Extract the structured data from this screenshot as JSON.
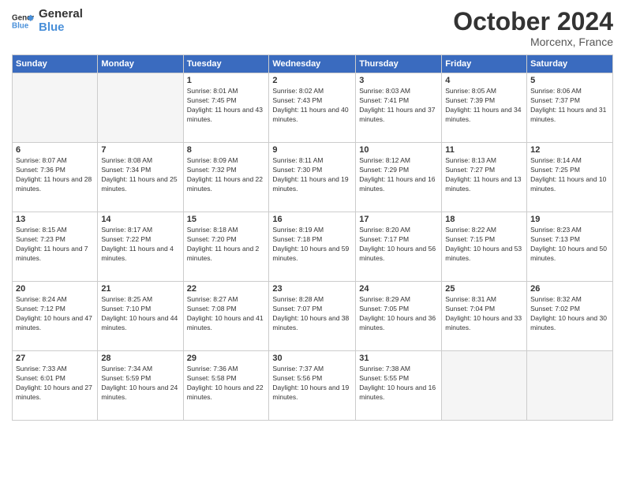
{
  "logo": {
    "line1": "General",
    "line2": "Blue"
  },
  "title": "October 2024",
  "location": "Morcenx, France",
  "days_of_week": [
    "Sunday",
    "Monday",
    "Tuesday",
    "Wednesday",
    "Thursday",
    "Friday",
    "Saturday"
  ],
  "weeks": [
    [
      {
        "day": "",
        "info": ""
      },
      {
        "day": "",
        "info": ""
      },
      {
        "day": "1",
        "info": "Sunrise: 8:01 AM\nSunset: 7:45 PM\nDaylight: 11 hours and 43 minutes."
      },
      {
        "day": "2",
        "info": "Sunrise: 8:02 AM\nSunset: 7:43 PM\nDaylight: 11 hours and 40 minutes."
      },
      {
        "day": "3",
        "info": "Sunrise: 8:03 AM\nSunset: 7:41 PM\nDaylight: 11 hours and 37 minutes."
      },
      {
        "day": "4",
        "info": "Sunrise: 8:05 AM\nSunset: 7:39 PM\nDaylight: 11 hours and 34 minutes."
      },
      {
        "day": "5",
        "info": "Sunrise: 8:06 AM\nSunset: 7:37 PM\nDaylight: 11 hours and 31 minutes."
      }
    ],
    [
      {
        "day": "6",
        "info": "Sunrise: 8:07 AM\nSunset: 7:36 PM\nDaylight: 11 hours and 28 minutes."
      },
      {
        "day": "7",
        "info": "Sunrise: 8:08 AM\nSunset: 7:34 PM\nDaylight: 11 hours and 25 minutes."
      },
      {
        "day": "8",
        "info": "Sunrise: 8:09 AM\nSunset: 7:32 PM\nDaylight: 11 hours and 22 minutes."
      },
      {
        "day": "9",
        "info": "Sunrise: 8:11 AM\nSunset: 7:30 PM\nDaylight: 11 hours and 19 minutes."
      },
      {
        "day": "10",
        "info": "Sunrise: 8:12 AM\nSunset: 7:29 PM\nDaylight: 11 hours and 16 minutes."
      },
      {
        "day": "11",
        "info": "Sunrise: 8:13 AM\nSunset: 7:27 PM\nDaylight: 11 hours and 13 minutes."
      },
      {
        "day": "12",
        "info": "Sunrise: 8:14 AM\nSunset: 7:25 PM\nDaylight: 11 hours and 10 minutes."
      }
    ],
    [
      {
        "day": "13",
        "info": "Sunrise: 8:15 AM\nSunset: 7:23 PM\nDaylight: 11 hours and 7 minutes."
      },
      {
        "day": "14",
        "info": "Sunrise: 8:17 AM\nSunset: 7:22 PM\nDaylight: 11 hours and 4 minutes."
      },
      {
        "day": "15",
        "info": "Sunrise: 8:18 AM\nSunset: 7:20 PM\nDaylight: 11 hours and 2 minutes."
      },
      {
        "day": "16",
        "info": "Sunrise: 8:19 AM\nSunset: 7:18 PM\nDaylight: 10 hours and 59 minutes."
      },
      {
        "day": "17",
        "info": "Sunrise: 8:20 AM\nSunset: 7:17 PM\nDaylight: 10 hours and 56 minutes."
      },
      {
        "day": "18",
        "info": "Sunrise: 8:22 AM\nSunset: 7:15 PM\nDaylight: 10 hours and 53 minutes."
      },
      {
        "day": "19",
        "info": "Sunrise: 8:23 AM\nSunset: 7:13 PM\nDaylight: 10 hours and 50 minutes."
      }
    ],
    [
      {
        "day": "20",
        "info": "Sunrise: 8:24 AM\nSunset: 7:12 PM\nDaylight: 10 hours and 47 minutes."
      },
      {
        "day": "21",
        "info": "Sunrise: 8:25 AM\nSunset: 7:10 PM\nDaylight: 10 hours and 44 minutes."
      },
      {
        "day": "22",
        "info": "Sunrise: 8:27 AM\nSunset: 7:08 PM\nDaylight: 10 hours and 41 minutes."
      },
      {
        "day": "23",
        "info": "Sunrise: 8:28 AM\nSunset: 7:07 PM\nDaylight: 10 hours and 38 minutes."
      },
      {
        "day": "24",
        "info": "Sunrise: 8:29 AM\nSunset: 7:05 PM\nDaylight: 10 hours and 36 minutes."
      },
      {
        "day": "25",
        "info": "Sunrise: 8:31 AM\nSunset: 7:04 PM\nDaylight: 10 hours and 33 minutes."
      },
      {
        "day": "26",
        "info": "Sunrise: 8:32 AM\nSunset: 7:02 PM\nDaylight: 10 hours and 30 minutes."
      }
    ],
    [
      {
        "day": "27",
        "info": "Sunrise: 7:33 AM\nSunset: 6:01 PM\nDaylight: 10 hours and 27 minutes."
      },
      {
        "day": "28",
        "info": "Sunrise: 7:34 AM\nSunset: 5:59 PM\nDaylight: 10 hours and 24 minutes."
      },
      {
        "day": "29",
        "info": "Sunrise: 7:36 AM\nSunset: 5:58 PM\nDaylight: 10 hours and 22 minutes."
      },
      {
        "day": "30",
        "info": "Sunrise: 7:37 AM\nSunset: 5:56 PM\nDaylight: 10 hours and 19 minutes."
      },
      {
        "day": "31",
        "info": "Sunrise: 7:38 AM\nSunset: 5:55 PM\nDaylight: 10 hours and 16 minutes."
      },
      {
        "day": "",
        "info": ""
      },
      {
        "day": "",
        "info": ""
      }
    ]
  ]
}
